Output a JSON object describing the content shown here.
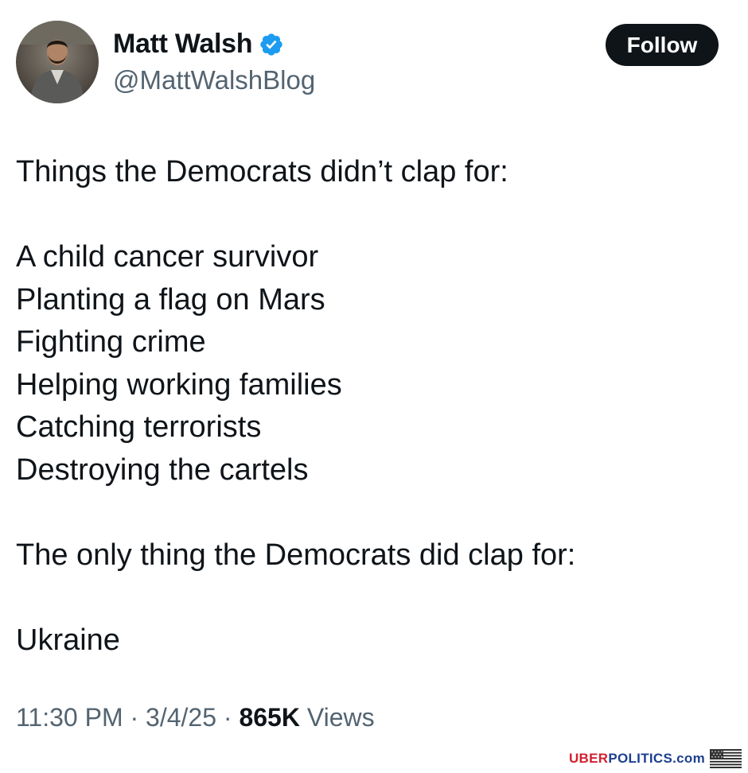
{
  "user": {
    "name": "Matt Walsh",
    "handle": "@MattWalshBlog",
    "verified": true,
    "avatar_icon": "profile-photo"
  },
  "follow_button": {
    "label": "Follow"
  },
  "tweet": {
    "lines": [
      "Things the Democrats didn’t clap for:",
      "",
      "A child cancer survivor",
      "Planting a flag on Mars",
      "Fighting crime",
      "Helping working families",
      "Catching terrorists",
      "Destroying the cartels",
      "",
      "The only thing the Democrats did clap for:",
      "",
      "Ukraine"
    ]
  },
  "meta": {
    "time": "11:30 PM",
    "sep1": " · ",
    "date": "3/4/25",
    "sep2": " · ",
    "views_count": "865K",
    "views_label": " Views"
  },
  "watermark": {
    "part1": "UBER",
    "part2": "POLITICS.com",
    "colors": {
      "red": "#d2202f",
      "blue": "#1c3f8f"
    }
  },
  "colors": {
    "text": "#0f1419",
    "secondary": "#536471",
    "verified_blue": "#1d9bf0",
    "button_bg": "#0f1419"
  }
}
